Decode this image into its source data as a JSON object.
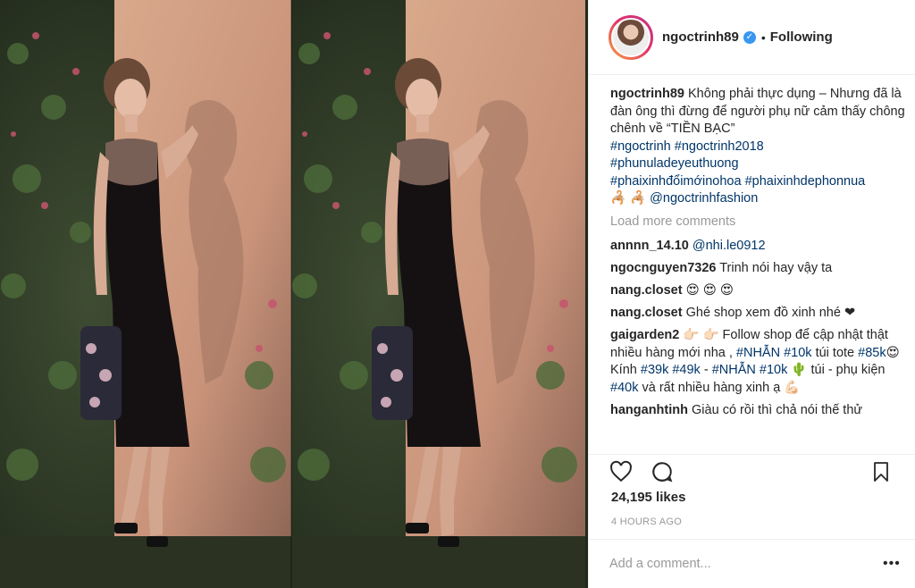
{
  "header": {
    "username": "ngoctrinh89",
    "verified_mark": "✓",
    "separator": "•",
    "follow_status": "Following"
  },
  "caption": {
    "username": "ngoctrinh89",
    "text": "Không phải thực dụng – Nhưng đã là đàn ông thì đừng để người phụ nữ cảm thấy chông chênh về “TIỀN BẠC”",
    "tags": [
      "#ngoctrinh",
      "#ngoctrinh2018",
      "#phunuladeyeuthuong",
      "#phaixinhđổimớinohoa",
      "#phaixinhdephonnua"
    ],
    "emoji": "🦂 🦂",
    "mention": "@ngoctrinhfashion"
  },
  "load_more": "Load more comments",
  "comments": [
    {
      "user": "annnn_14.10",
      "text": "",
      "mention": "@nhi.le0912"
    },
    {
      "user": "ngocnguyen7326",
      "text": "Trinh nói hay vậy ta"
    },
    {
      "user": "nang.closet",
      "text": "😍 😍 😍"
    },
    {
      "user": "nang.closet",
      "text": "Ghé shop xem đồ xinh nhé ❤"
    },
    {
      "user": "gaigarden2",
      "text_a": "👉🏻 👉🏻 Follow shop để cập nhật thật nhiều hàng mới nha ,",
      "tag_a": "#NHẪN",
      "tag_b": "#10k",
      "text_b": "túi tote",
      "tag_c": "#85k",
      "text_c": "😍 Kính",
      "tag_d": "#39k",
      "tag_e": "#49k",
      "text_d": "-",
      "tag_f": "#NHẪN",
      "tag_g": "#10k",
      "text_e": "🌵 túi - phụ kiện",
      "tag_h": "#40k",
      "text_f": "và rất nhiều hàng xinh ạ 💪🏻"
    },
    {
      "user": "hanganhtinh",
      "text": "Giàu có rồi thì chả nói thế thử"
    }
  ],
  "actions": {
    "like_icon": "heart-outline",
    "comment_icon": "speech-bubble",
    "save_icon": "bookmark-outline"
  },
  "likes": "24,195 likes",
  "time": "4 HOURS AGO",
  "add_comment": {
    "placeholder": "Add a comment...",
    "more": "•••"
  }
}
